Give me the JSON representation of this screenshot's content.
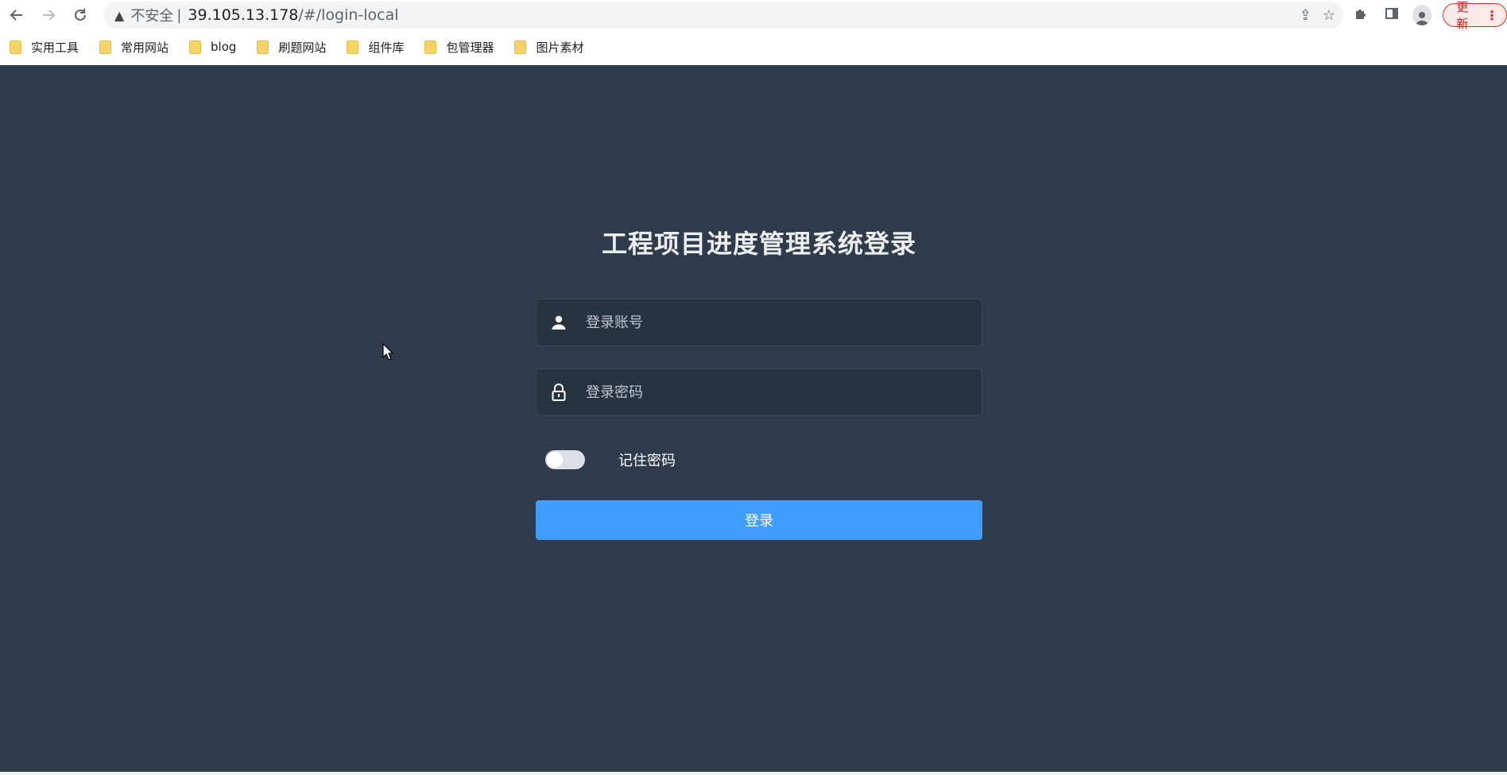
{
  "browser": {
    "address": {
      "security_label": "不安全",
      "separator": "|",
      "host": "39.105.13.178",
      "path": "/#/login-local"
    },
    "update_label": "更新",
    "bookmarks": [
      {
        "label": "实用工具"
      },
      {
        "label": "常用网站"
      },
      {
        "label": "blog"
      },
      {
        "label": "刷题网站"
      },
      {
        "label": "组件库"
      },
      {
        "label": "包管理器"
      },
      {
        "label": "图片素材"
      }
    ]
  },
  "login": {
    "title": "工程项目进度管理系统登录",
    "username_placeholder": "登录账号",
    "password_placeholder": "登录密码",
    "remember_label": "记住密码",
    "remember_on": false,
    "submit_label": "登录"
  },
  "colors": {
    "background": "#2d3a4b",
    "primary": "#409eff",
    "title": "#eeeeee"
  }
}
